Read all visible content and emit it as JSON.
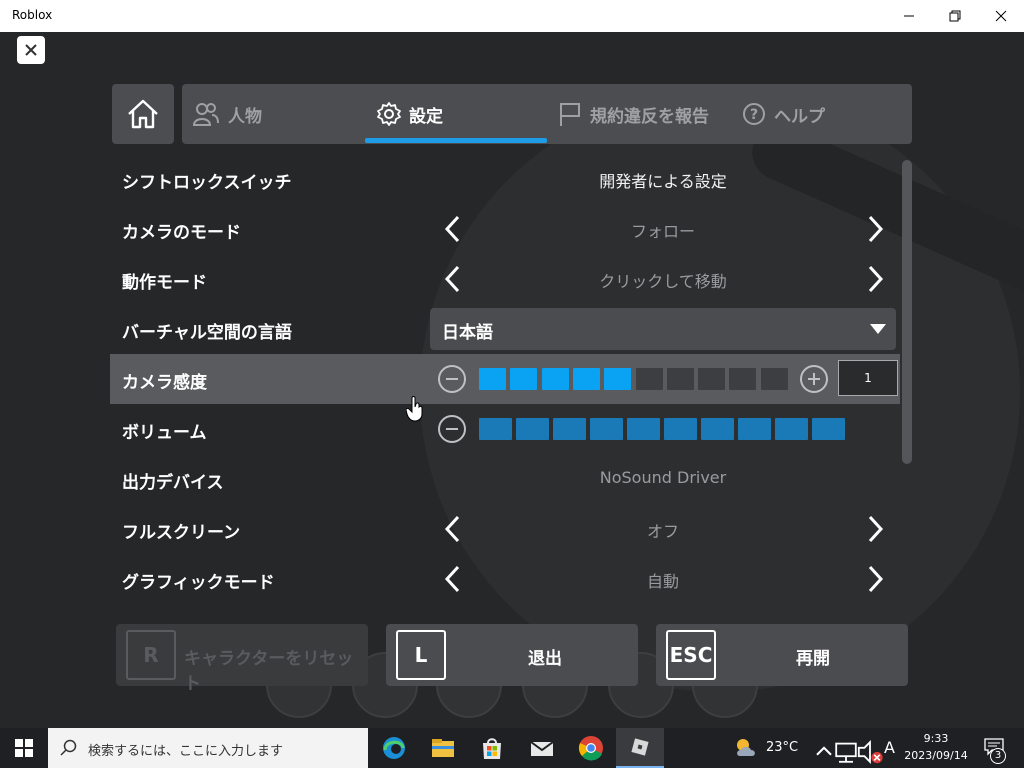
{
  "window": {
    "title": "Roblox"
  },
  "menu": {
    "tabs": [
      {
        "label": "人物",
        "icon": "people-icon"
      },
      {
        "label": "設定",
        "icon": "gear-icon",
        "active": true
      },
      {
        "label": "規約違反を報告",
        "icon": "flag-icon"
      },
      {
        "label": "ヘルプ",
        "icon": "help-icon"
      }
    ]
  },
  "settings": [
    {
      "label": "シフトロックスイッチ",
      "value": "開発者による設定"
    },
    {
      "label": "カメラのモード",
      "value": "フォロー"
    },
    {
      "label": "動作モード",
      "value": "クリックして移動"
    },
    {
      "label": "バーチャル空間の言語",
      "value": "日本語"
    },
    {
      "label": "カメラ感度",
      "level": 5,
      "max": 10,
      "number": "1"
    },
    {
      "label": "ボリューム",
      "level": 10,
      "max": 10
    },
    {
      "label": "出力デバイス",
      "value": "NoSound Driver"
    },
    {
      "label": "フルスクリーン",
      "value": "オフ"
    },
    {
      "label": "グラフィックモード",
      "value": "自動"
    }
  ],
  "buttons": {
    "reset": {
      "key": "R",
      "label": "キャラクターをリセット"
    },
    "leave": {
      "key": "L",
      "label": "退出"
    },
    "resume": {
      "key": "ESC",
      "label": "再開"
    }
  },
  "taskbar": {
    "search_placeholder": "検索するには、ここに入力します",
    "weather": "23°C",
    "ime": "A",
    "time": "9:33",
    "date": "2023/09/14",
    "notifications": "3"
  },
  "colors": {
    "accent": "#1f9ce8",
    "slider_active_bright": "#0aa2f2",
    "slider_active": "#1a7ab8",
    "slider_inactive": "#3d3e41"
  }
}
